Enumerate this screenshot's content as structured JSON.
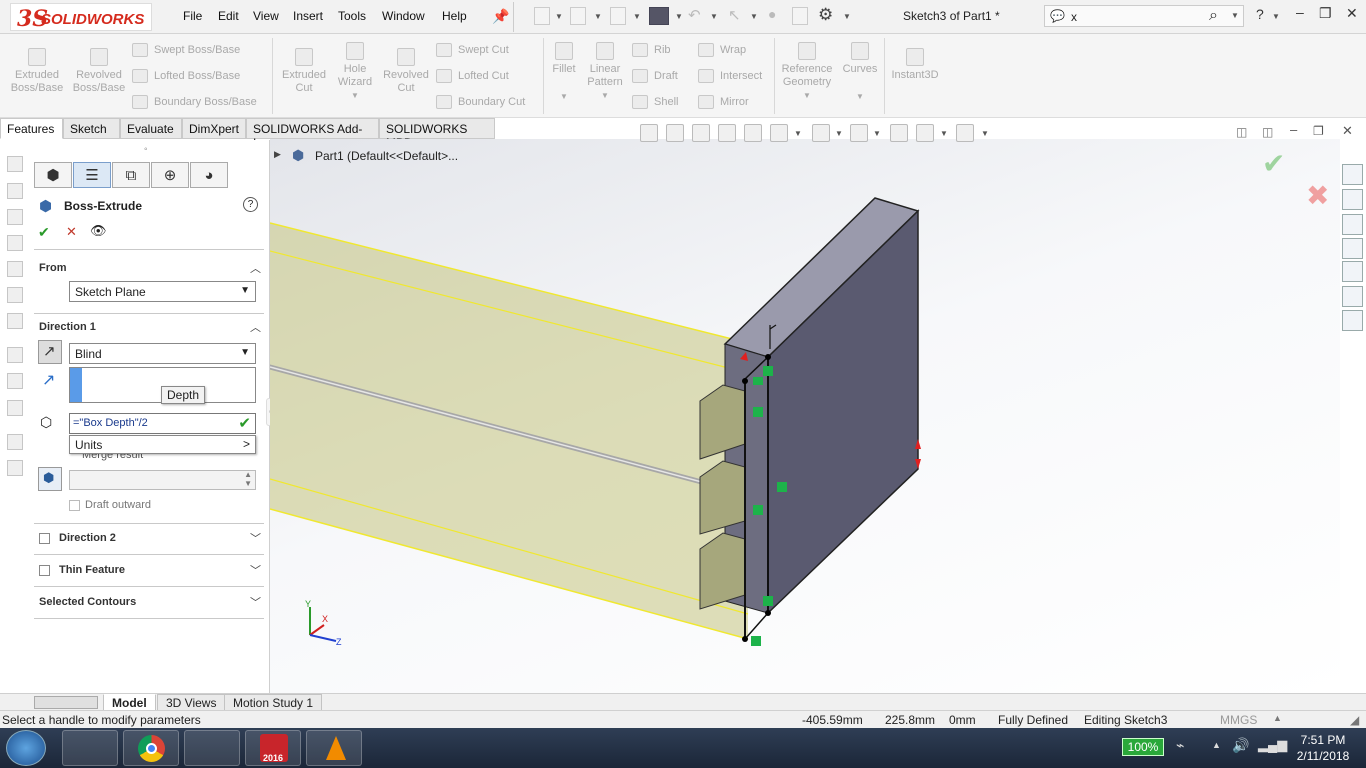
{
  "app": {
    "brand_ds": "3S",
    "brand_name": "SOLIDWORKS",
    "document_title": "Sketch3 of Part1 *"
  },
  "menu": [
    "File",
    "Edit",
    "View",
    "Insert",
    "Tools",
    "Window",
    "Help"
  ],
  "search": {
    "value": "x"
  },
  "title_controls": [
    "?",
    "–",
    "❐",
    "✕"
  ],
  "command_manager": {
    "big_buttons": [
      {
        "label": "Extruded Boss/Base"
      },
      {
        "label": "Revolved Boss/Base"
      },
      {
        "label": "Extruded Cut"
      },
      {
        "label": "Hole Wizard"
      },
      {
        "label": "Revolved Cut"
      },
      {
        "label": "Fillet"
      },
      {
        "label": "Linear Pattern"
      },
      {
        "label": "Reference Geometry"
      },
      {
        "label": "Curves"
      },
      {
        "label": "Instant3D"
      }
    ],
    "stack_boss": [
      "Swept Boss/Base",
      "Lofted Boss/Base",
      "Boundary Boss/Base"
    ],
    "stack_cut": [
      "Swept Cut",
      "Lofted Cut",
      "Boundary Cut"
    ],
    "stack_feat1": [
      "Rib",
      "Draft",
      "Shell"
    ],
    "stack_feat2": [
      "Wrap",
      "Intersect",
      "Mirror"
    ]
  },
  "tabs": [
    "Features",
    "Sketch",
    "Evaluate",
    "DimXpert",
    "SOLIDWORKS Add-Ins",
    "SOLIDWORKS MBD"
  ],
  "tree": {
    "root": "Part1  (Default<<Default>..."
  },
  "property_manager": {
    "title": "Boss-Extrude",
    "help": "?",
    "ok": "✔",
    "cancel": "✕",
    "preview": "👁",
    "from": {
      "title": "From",
      "value": "Sketch Plane"
    },
    "direction1": {
      "title": "Direction 1",
      "end_condition": "Blind",
      "tooltip": "Depth",
      "depth_input": "=\"Box Depth\"/2",
      "popup_item": "Units",
      "popup_arrow": ">",
      "hidden_label": "Merge result",
      "draft_outward": "Draft outward"
    },
    "direction2": {
      "title": "Direction 2"
    },
    "thin_feature": {
      "title": "Thin Feature"
    },
    "selected_contours": {
      "title": "Selected Contours"
    }
  },
  "triad": {
    "x": "X",
    "y": "Y",
    "z": "Z"
  },
  "bottom_tabs": [
    "Model",
    "3D Views",
    "Motion Study 1"
  ],
  "status": {
    "message": "Select a handle to modify parameters",
    "x": "-405.59mm",
    "y": "225.8mm",
    "z": "0mm",
    "state": "Fully Defined",
    "mode": "Editing Sketch3",
    "units": "MMGS"
  },
  "taskbar": {
    "battery": "100%",
    "time": "7:51 PM",
    "date": "2/11/2018",
    "sw_badge": "2016"
  }
}
